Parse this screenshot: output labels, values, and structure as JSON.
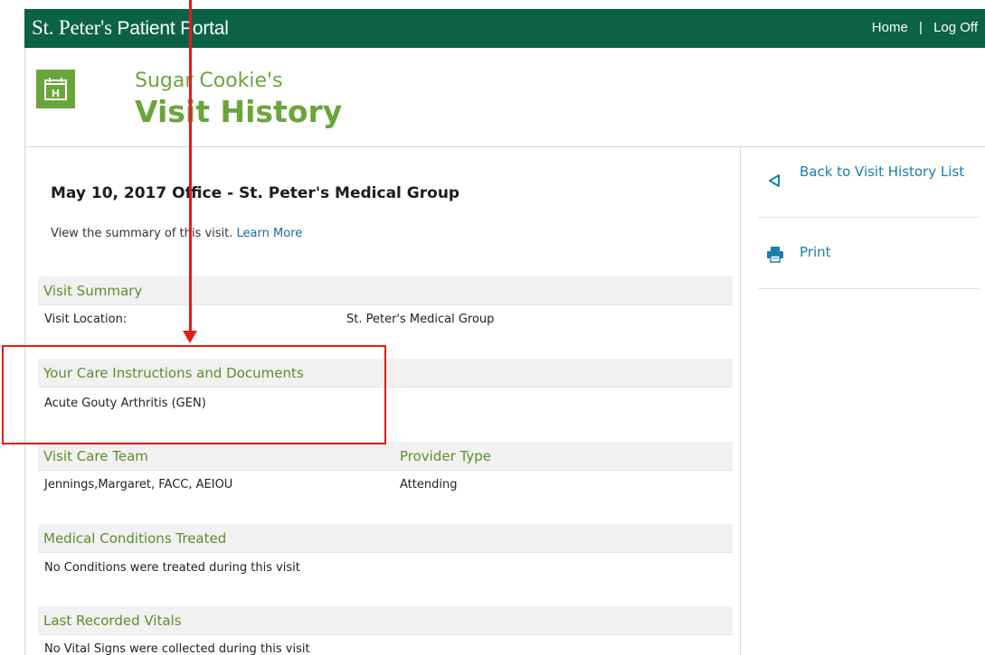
{
  "topbar": {
    "brand_main": "St. Peter's",
    "brand_tail": " Patient Portal",
    "nav_home": "Home",
    "nav_sep": "|",
    "nav_logoff": "Log Off",
    "color": "#0b6246"
  },
  "header": {
    "icon": "hospital-calendar-icon",
    "icon_letter": "H",
    "owner": "Sugar Cookie's",
    "title": "Visit History",
    "accent": "#6aa53c"
  },
  "visit": {
    "heading": "May 10, 2017 Office - St. Peter's Medical Group",
    "description": "View the summary of this visit.",
    "learn_more": "Learn More"
  },
  "sections": {
    "summary": {
      "title": "Visit Summary",
      "location_label": "Visit Location:",
      "location_value": "St. Peter's Medical Group"
    },
    "care": {
      "title": "Your Care Instructions and Documents",
      "item": "Acute Gouty Arthritis (GEN)"
    },
    "team": {
      "title": "Visit Care Team",
      "type_title": "Provider Type",
      "member": "Jennings,Margaret, FACC, AEIOU",
      "member_type": "Attending"
    },
    "conditions": {
      "title": "Medical Conditions Treated",
      "text": "No Conditions were treated during this visit"
    },
    "vitals": {
      "title": "Last Recorded Vitals",
      "text": "No Vital Signs were collected during this visit"
    }
  },
  "sidebar": {
    "back_label": "Back to Visit History List",
    "back_icon": "triangle-left-icon",
    "print_label": "Print",
    "print_icon": "printer-icon",
    "link_color": "#1a7fae"
  },
  "annotation": {
    "color": "#e31b1b"
  }
}
